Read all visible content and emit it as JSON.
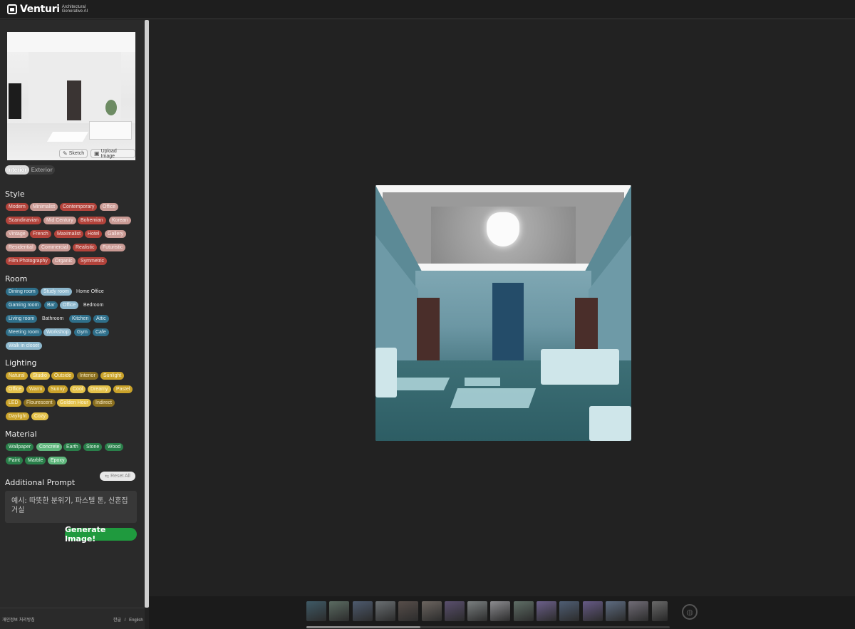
{
  "header": {
    "brand": "Venturi",
    "tagline_line1": "Architectural",
    "tagline_line2": "Generative AI"
  },
  "preview": {
    "sketch_label": "Sketch",
    "upload_label": "Upload Image"
  },
  "mode_toggle": {
    "interior": "Interior",
    "exterior": "Exterior",
    "selected": "Interior"
  },
  "sections": {
    "style": "Style",
    "room": "Room",
    "lighting": "Lighting",
    "material": "Material",
    "additional_prompt": "Additional Prompt"
  },
  "style_tags": [
    "Modern",
    "Minimalist",
    "Contemporary",
    "Office",
    "Scandinavian",
    "Mid Century",
    "Bohemian",
    "Korean",
    "Vintage",
    "French",
    "Maximalist",
    "Hotel",
    "Gallery",
    "Residential",
    "Commercial",
    "Realistic",
    "Futuristic",
    "Film Photography",
    "Organic",
    "Symmetric"
  ],
  "room_tags": [
    "Dining room",
    "Study room",
    "Home Office",
    "Gaming room",
    "Bar",
    "Office",
    "Bedroom",
    "Living room",
    "Bathroom",
    "Kitchen",
    "Attic",
    "Meeting room",
    "Workshop",
    "Gym",
    "Cafe",
    "Walk in closet"
  ],
  "lighting_tags": [
    "Natural",
    "Studio",
    "Outside",
    "Interior",
    "Sunlight",
    "Office",
    "Warm",
    "Sunny",
    "Cool",
    "Dreamy",
    "Pastel",
    "LED",
    "Flourescent",
    "Golden Hour",
    "Indirect",
    "Daylight",
    "Cozy"
  ],
  "material_tags": [
    "Wallpaper",
    "Concrete",
    "Earth",
    "Stone",
    "Wood",
    "Paint",
    "Marble",
    "Epoxy"
  ],
  "reset_label": "Reset All",
  "prompt_placeholder": "예시: 따뜻한 분위기, 파스텔 톤, 신혼집 거실",
  "generate_label": "Generate Image!",
  "footer": {
    "privacy": "개인정보 처리방침",
    "lang_ko": "한글",
    "lang_sep": "/",
    "lang_en": "English"
  },
  "colors": {
    "accent_green": "#1f9a3e",
    "style_red": "#b2433b",
    "room_blue": "#2f6f8a",
    "lighting_yellow": "#c9a22a",
    "material_green": "#2a7f4a"
  },
  "thumbnail_count": 16
}
